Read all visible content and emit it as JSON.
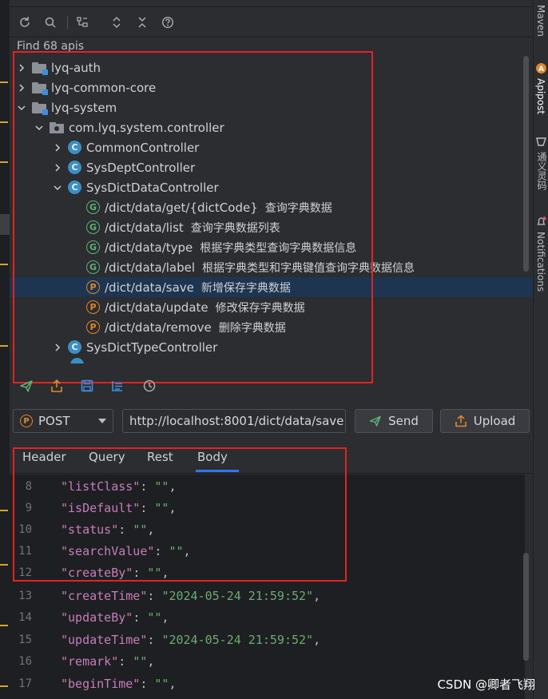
{
  "panel": {
    "find_text": "Find 68 apis",
    "toolbar_icons": [
      "refresh-icon",
      "search-icon",
      "tree-structure-icon",
      "expand-all-icon",
      "collapse-all-icon",
      "help-icon"
    ]
  },
  "tree": {
    "modules": [
      {
        "label": "lyq-auth",
        "expanded": false
      },
      {
        "label": "lyq-common-core",
        "expanded": false
      },
      {
        "label": "lyq-system",
        "expanded": true
      }
    ],
    "package": "com.lyq.system.controller",
    "controllers": [
      {
        "label": "CommonController",
        "expanded": false
      },
      {
        "label": "SysDeptController",
        "expanded": false
      },
      {
        "label": "SysDictDataController",
        "expanded": true
      },
      {
        "label": "SysDictTypeController",
        "expanded": false
      }
    ],
    "class_badge": "C",
    "apis": [
      {
        "method": "G",
        "path": "/dict/data/get/{dictCode}",
        "desc": "查询字典数据"
      },
      {
        "method": "G",
        "path": "/dict/data/list",
        "desc": "查询字典数据列表"
      },
      {
        "method": "G",
        "path": "/dict/data/type",
        "desc": "根据字典类型查询字典数据信息"
      },
      {
        "method": "G",
        "path": "/dict/data/label",
        "desc": "根据字典类型和字典键值查询字典数据信息"
      },
      {
        "method": "P",
        "path": "/dict/data/save",
        "desc": "新增保存字典数据",
        "selected": true
      },
      {
        "method": "P",
        "path": "/dict/data/update",
        "desc": "修改保存字典数据"
      },
      {
        "method": "P",
        "path": "/dict/data/remove",
        "desc": "删除字典数据"
      }
    ]
  },
  "actions": [
    "send-icon",
    "export-icon",
    "save-icon",
    "list-icon",
    "history-icon"
  ],
  "request": {
    "method_badge": "P",
    "method": "POST",
    "url": "http://localhost:8001/dict/data/save",
    "send_label": "Send",
    "upload_label": "Upload"
  },
  "tabs": [
    "Header",
    "Query",
    "Rest",
    "Body"
  ],
  "active_tab": "Body",
  "editor": {
    "lines": [
      {
        "n": "8",
        "key": "\"listClass\"",
        "val": "\"\""
      },
      {
        "n": "9",
        "key": "\"isDefault\"",
        "val": "\"\""
      },
      {
        "n": "10",
        "key": "\"status\"",
        "val": "\"\""
      },
      {
        "n": "11",
        "key": "\"searchValue\"",
        "val": "\"\""
      },
      {
        "n": "12",
        "key": "\"createBy\"",
        "val": "\"\""
      },
      {
        "n": "13",
        "key": "\"createTime\"",
        "val": "\"2024-05-24 21:59:52\""
      },
      {
        "n": "14",
        "key": "\"updateBy\"",
        "val": "\"\""
      },
      {
        "n": "15",
        "key": "\"updateTime\"",
        "val": "\"2024-05-24 21:59:52\""
      },
      {
        "n": "16",
        "key": "\"remark\"",
        "val": "\"\""
      },
      {
        "n": "17",
        "key": "\"beginTime\"",
        "val": "\"\""
      }
    ]
  },
  "right_sidebar": {
    "maven": "Maven",
    "apipost": "Apipost",
    "translate": "通义灵码",
    "notifications": "Notifications"
  },
  "watermark": "CSDN @卿者飞翔",
  "colors": {
    "background": "#2b2d30",
    "editor_bg": "#1e1f22",
    "selection": "#1d3550",
    "highlight_box": "#e02424",
    "get_method": "#5fb27a",
    "post_method": "#e0862d",
    "class_icon": "#3b8ec2",
    "json_key": "#c77dbb",
    "json_string": "#6aab73",
    "tab_underline": "#3574f0"
  }
}
